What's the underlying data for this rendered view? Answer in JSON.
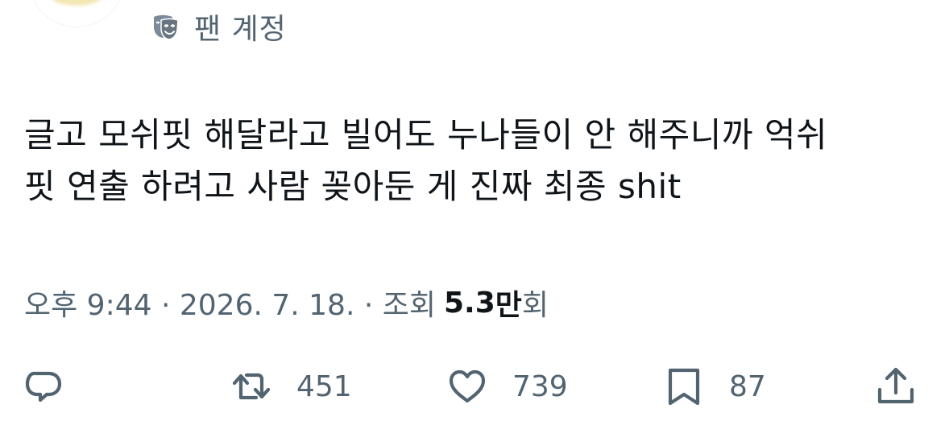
{
  "header": {
    "fan_account_label": "팬 계정"
  },
  "tweet": {
    "lines": [
      "글고 모쉬핏 해달라고 빌어도 누나들이 안 해주니까 억쉬",
      "핏 연출 하려고 사람 꽂아둔 게 진짜 최종 shit"
    ]
  },
  "meta": {
    "time_date": "오후 9:44 · 2026. 7. 18. · 조회",
    "views_number": "5.3",
    "views_unit": "만",
    "views_suffix": "회"
  },
  "actions": {
    "reply_count": "",
    "retweet_count": "451",
    "like_count": "739",
    "bookmark_count": "87"
  },
  "icons": {
    "fan": "masks-icon",
    "reply": "reply-icon",
    "retweet": "retweet-icon",
    "like": "heart-icon",
    "bookmark": "bookmark-icon",
    "share": "share-icon"
  },
  "colors": {
    "text_primary": "#0f1419",
    "text_secondary": "#536471",
    "icon_gray": "#536471",
    "fan_icon": "#66757f"
  }
}
